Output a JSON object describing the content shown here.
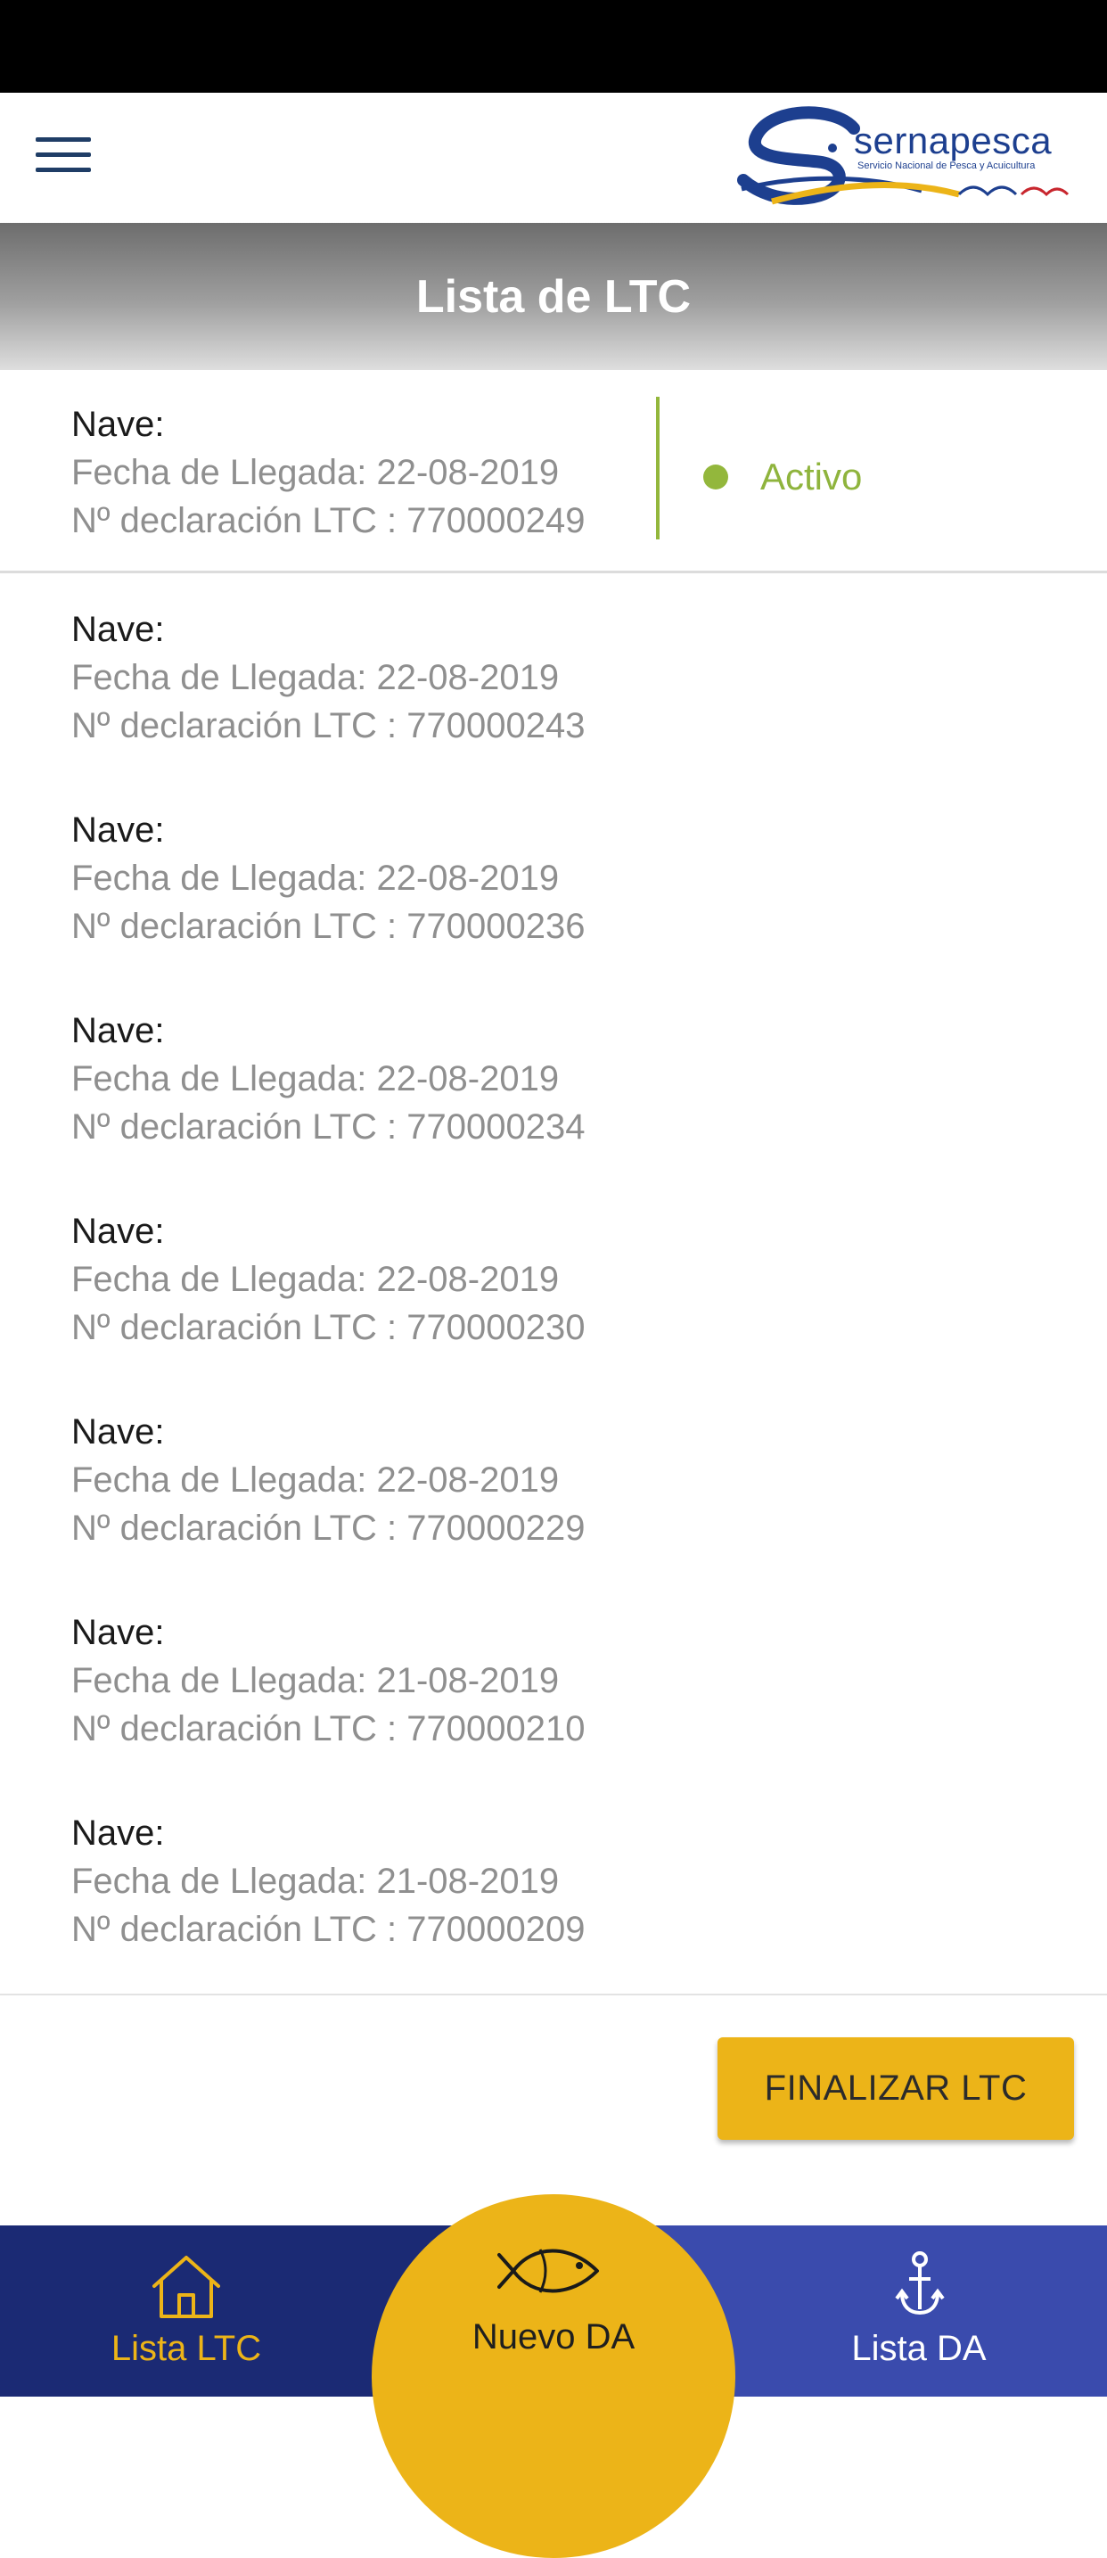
{
  "header": {
    "logo_name": "sernapesca",
    "logo_subtitle": "Servicio Nacional de Pesca y Acuicultura",
    "menu_icon": "hamburger-menu-icon"
  },
  "title": "Lista de LTC",
  "status_color": "#93b73c",
  "accent_color": "#ecb418",
  "items": [
    {
      "nave": "Nave:",
      "fecha": "Fecha de Llegada: 22-08-2019",
      "declaracion": "Nº declaración LTC : 770000249",
      "status": "Activo"
    },
    {
      "nave": "Nave:",
      "fecha": "Fecha de Llegada: 22-08-2019",
      "declaracion": "Nº declaración LTC : 770000243"
    },
    {
      "nave": "Nave:",
      "fecha": "Fecha de Llegada: 22-08-2019",
      "declaracion": "Nº declaración LTC : 770000236"
    },
    {
      "nave": "Nave:",
      "fecha": "Fecha de Llegada: 22-08-2019",
      "declaracion": "Nº declaración LTC : 770000234"
    },
    {
      "nave": "Nave:",
      "fecha": "Fecha de Llegada: 22-08-2019",
      "declaracion": "Nº declaración LTC : 770000230"
    },
    {
      "nave": "Nave:",
      "fecha": "Fecha de Llegada: 22-08-2019",
      "declaracion": "Nº declaración LTC : 770000229"
    },
    {
      "nave": "Nave:",
      "fecha": "Fecha de Llegada: 21-08-2019",
      "declaracion": "Nº declaración LTC : 770000210"
    },
    {
      "nave": "Nave:",
      "fecha": "Fecha de Llegada: 21-08-2019",
      "declaracion": "Nº declaración LTC : 770000209"
    }
  ],
  "finalizar_label": "FINALIZAR LTC",
  "bottom_nav": {
    "left": {
      "label": "Lista LTC",
      "icon": "home-icon"
    },
    "center": {
      "label": "Nuevo DA",
      "icon": "fish-icon"
    },
    "right": {
      "label": "Lista DA",
      "icon": "anchor-icon"
    }
  }
}
